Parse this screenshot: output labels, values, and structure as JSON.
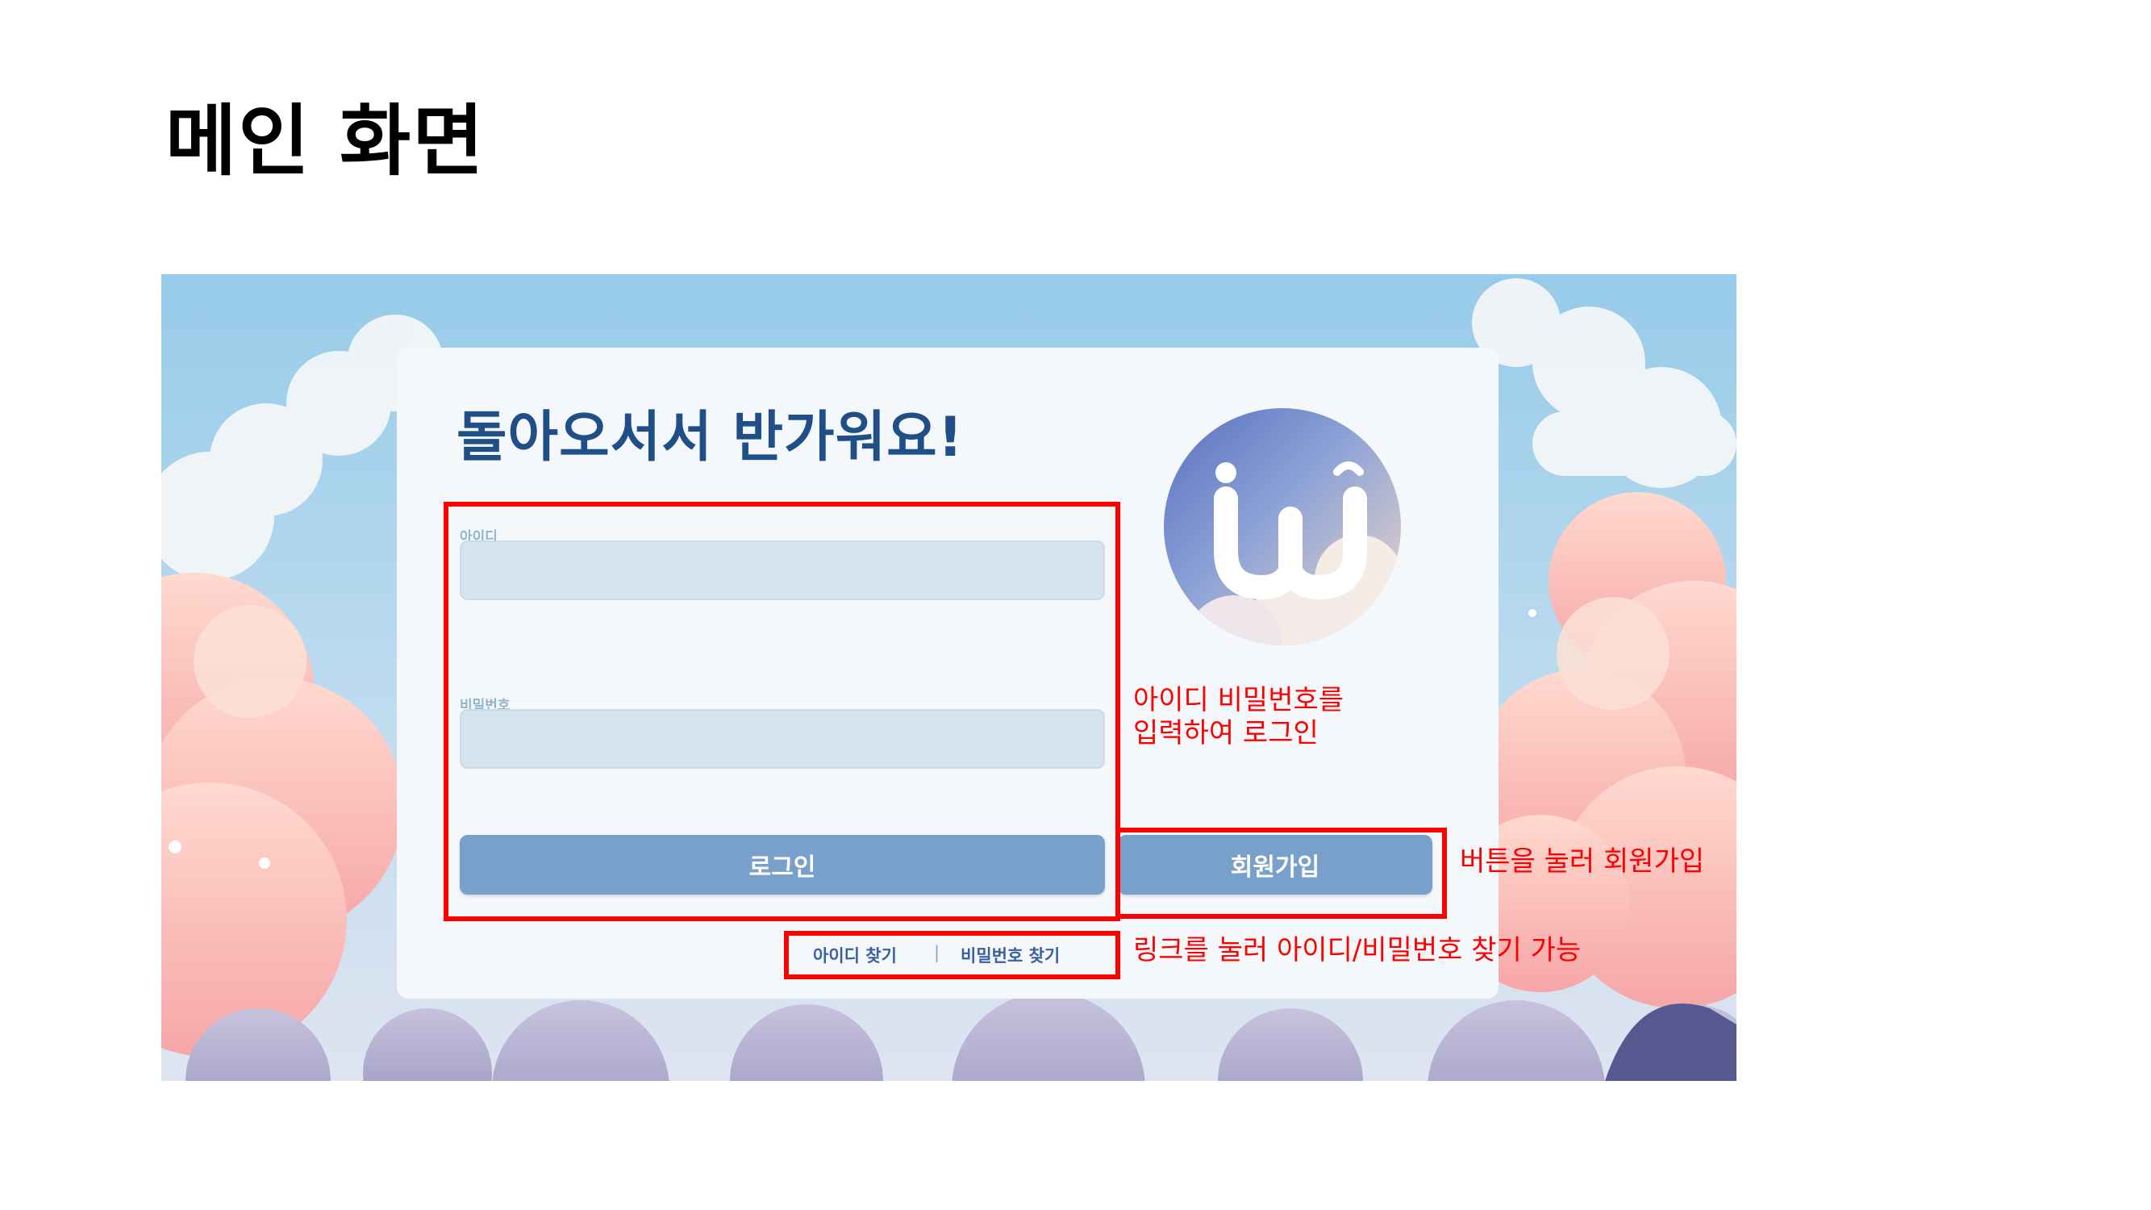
{
  "slide": {
    "title": "메인 화면"
  },
  "login_screen": {
    "heading": "돌아오서서 반가워요!",
    "id_label": "아이디",
    "id_value": "",
    "password_label": "비밀번호",
    "password_value": "",
    "login_button": "로그인",
    "signup_button": "회원가입",
    "find_id_link": "아이디 찾기",
    "link_separator": "|",
    "find_password_link": "비밀번호 찾기",
    "logo_icon": "cloud-w-logo-icon"
  },
  "annotations": {
    "login_note_line1": "아이디 비밀번호를",
    "login_note_line2": "입력하여 로그인",
    "signup_note": "버튼을 눌러 회원가입",
    "find_note": "링크를 눌러 아이디/비밀번호 찾기 가능",
    "highlight_color": "#ff0000"
  },
  "colors": {
    "heading": "#1f4f86",
    "button": "#799fcb",
    "input_fill": "#d5e4f0",
    "card": "#f5f8fa"
  }
}
